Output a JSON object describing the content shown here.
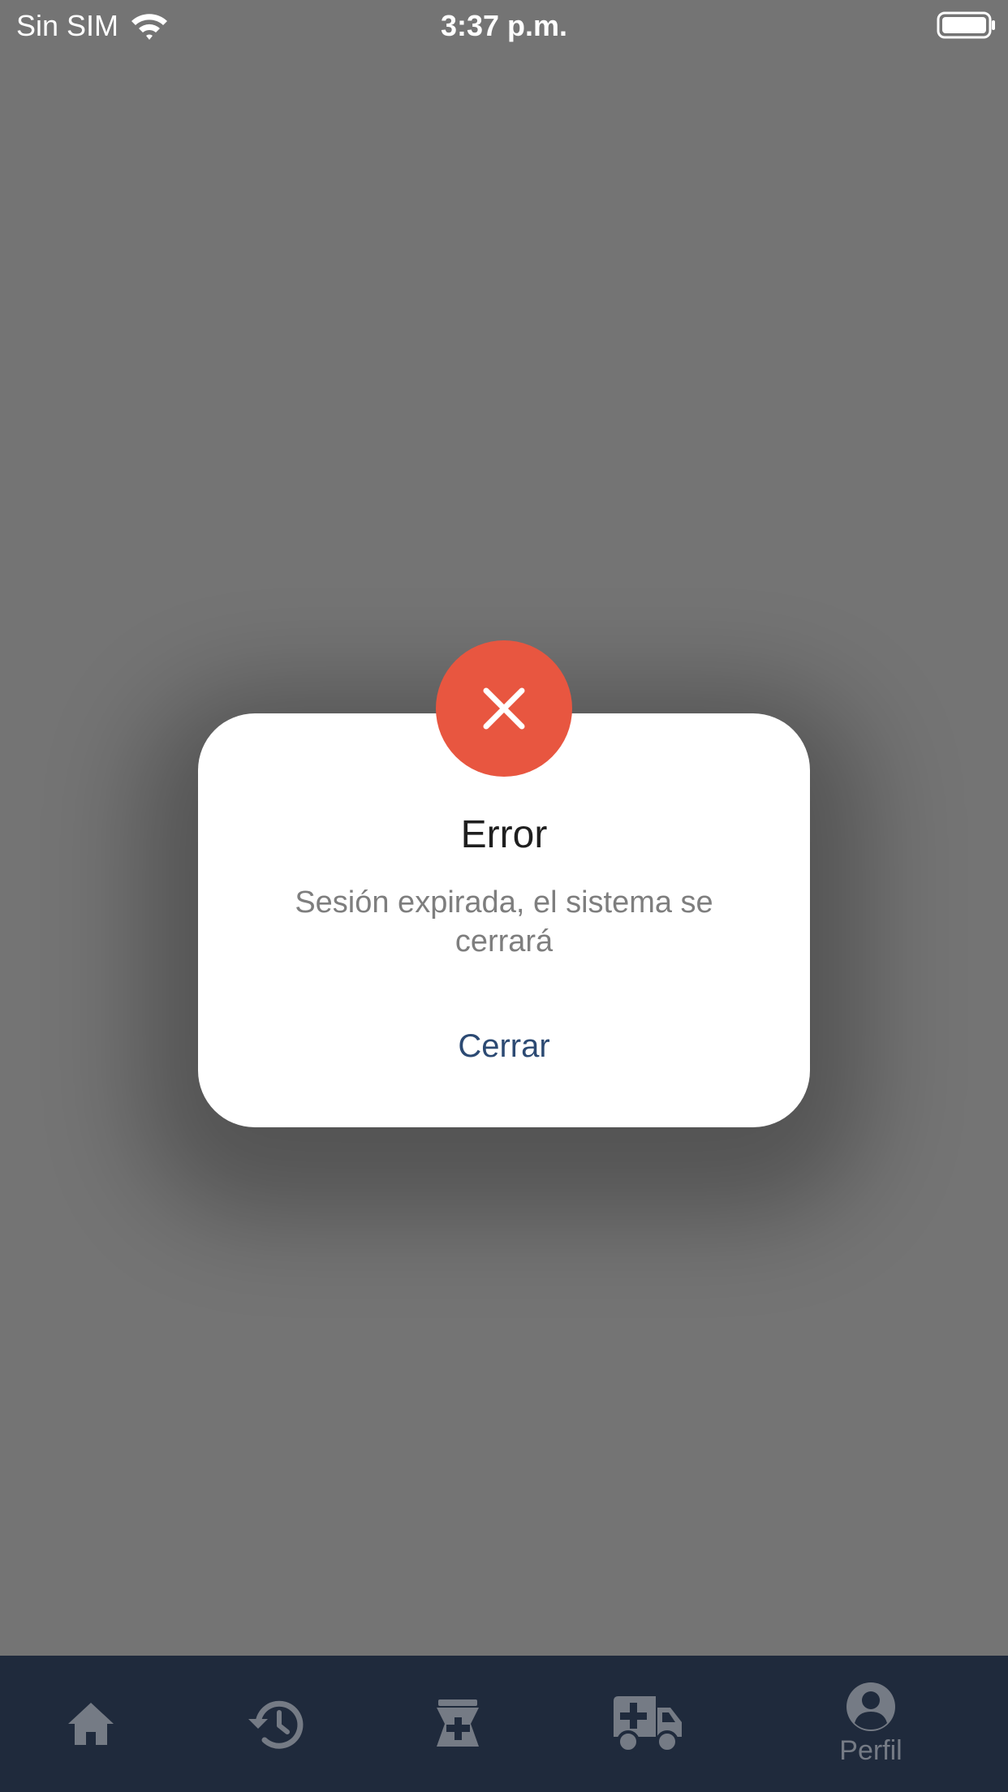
{
  "status_bar": {
    "carrier": "Sin SIM",
    "time": "3:37 p.m.",
    "wifi_icon": "wifi-icon",
    "battery_icon": "battery-icon"
  },
  "dialog": {
    "icon": "close-icon",
    "badge_color": "#e85640",
    "title": "Error",
    "message": "Sesión expirada, el sistema se cerrará",
    "close_label": "Cerrar",
    "close_color": "#2c4a73"
  },
  "bottom_nav": {
    "background": "#1f2a3c",
    "icon_color": "#757b85",
    "items": [
      {
        "icon": "home-icon",
        "label": ""
      },
      {
        "icon": "history-icon",
        "label": ""
      },
      {
        "icon": "pharmacy-icon",
        "label": ""
      },
      {
        "icon": "ambulance-icon",
        "label": ""
      },
      {
        "icon": "account-circle-icon",
        "label": "Perfil"
      }
    ]
  }
}
